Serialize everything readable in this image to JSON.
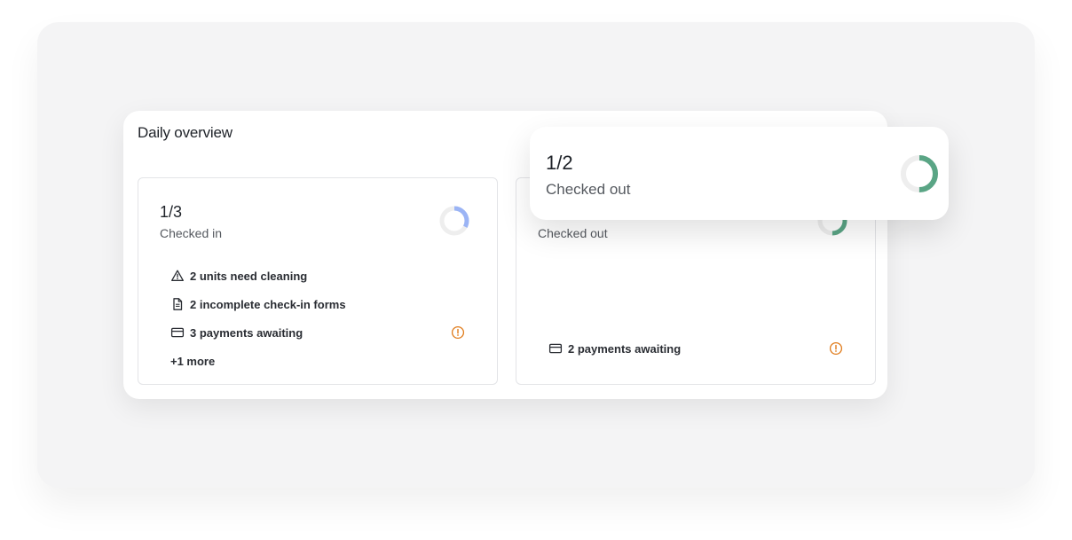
{
  "overview": {
    "title": "Daily overview"
  },
  "checked_in": {
    "count": "1/3",
    "label": "Checked in",
    "progress": 0.33,
    "ring_color": "#9bb4f5",
    "tasks": [
      {
        "icon": "warning-triangle-icon",
        "text": "2 units need cleaning",
        "alert": false
      },
      {
        "icon": "document-icon",
        "text": "2 incomplete check-in forms",
        "alert": false
      },
      {
        "icon": "credit-card-icon",
        "text": "3 payments awaiting",
        "alert": true
      }
    ],
    "more": "+1 more"
  },
  "checked_out": {
    "label": "Checked out",
    "ring_color": "#5aa585",
    "payment_text": "2 payments awaiting",
    "alert": true
  },
  "popup": {
    "count": "1/2",
    "label": "Checked out",
    "progress": 0.5,
    "ring_color": "#5aa585"
  },
  "colors": {
    "alert": "#e07b1a",
    "ring_track": "#eeeeee",
    "background": "#f4f4f5"
  }
}
